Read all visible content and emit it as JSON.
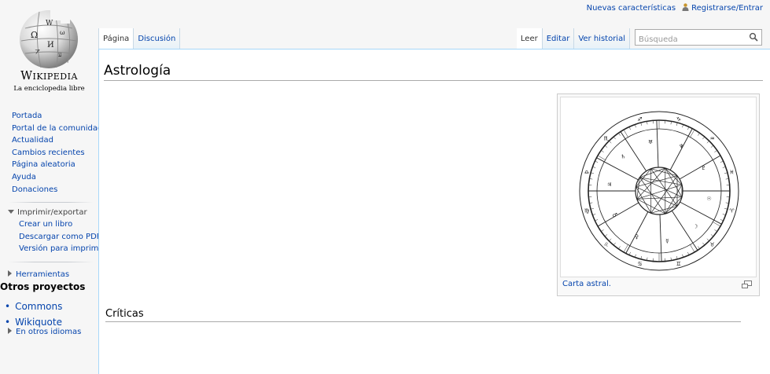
{
  "personal": {
    "new_features": "Nuevas características",
    "login": "Registrarse/Entrar"
  },
  "logo": {
    "wordmark_big_w": "W",
    "wordmark_rest": "IKIPEDIA",
    "tagline": "La enciclopedia libre"
  },
  "nav": {
    "items": [
      {
        "label": "Portada"
      },
      {
        "label": "Portal de la comunidad"
      },
      {
        "label": "Actualidad"
      },
      {
        "label": "Cambios recientes"
      },
      {
        "label": "Página aleatoria"
      },
      {
        "label": "Ayuda"
      },
      {
        "label": "Donaciones"
      }
    ],
    "print_heading": "Imprimir/exportar",
    "print_items": [
      {
        "label": "Crear un libro"
      },
      {
        "label": "Descargar como PDF"
      },
      {
        "label": "Versión para imprimir"
      }
    ],
    "tools_heading": "Herramientas",
    "other_projects": "Otros proyectos",
    "projects": [
      {
        "label": "Commons"
      },
      {
        "label": "Wikiquote"
      }
    ],
    "languages_heading": "En otros idiomas"
  },
  "tabs": {
    "left": [
      {
        "label": "Página",
        "selected": true
      },
      {
        "label": "Discusión",
        "selected": false
      }
    ],
    "right": [
      {
        "label": "Leer",
        "selected": true
      },
      {
        "label": "Editar",
        "selected": false
      },
      {
        "label": "Ver historial",
        "selected": false
      }
    ]
  },
  "search": {
    "placeholder": "Búsqueda",
    "icon": "magnifier-icon"
  },
  "article": {
    "title": "Astrología",
    "figure_caption": "Carta astral.",
    "section_heading": "Críticas"
  },
  "colors": {
    "link": "#0645ad",
    "content_border": "#a7d7f9",
    "sidebar_bg": "#f6f6f6"
  }
}
